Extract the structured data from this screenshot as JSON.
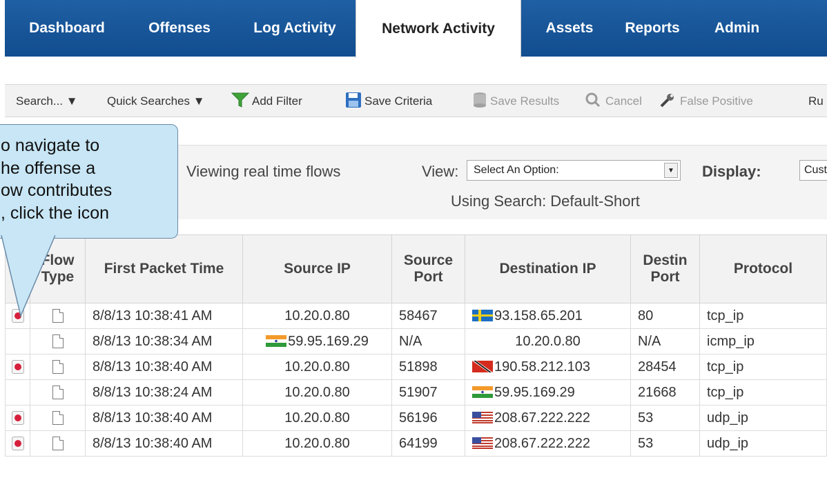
{
  "nav": {
    "tabs": [
      {
        "label": "Dashboard"
      },
      {
        "label": "Offenses"
      },
      {
        "label": "Log Activity"
      },
      {
        "label": "Network Activity",
        "active": true
      },
      {
        "label": "Assets"
      },
      {
        "label": "Reports"
      },
      {
        "label": "Admin"
      }
    ]
  },
  "toolbar": {
    "search": "Search... ▼",
    "quick_searches": "Quick Searches ▼",
    "add_filter": "Add Filter",
    "save_criteria": "Save Criteria",
    "save_results": "Save Results",
    "cancel": "Cancel",
    "false_positive": "False Positive",
    "rules_truncated": "Ru"
  },
  "info": {
    "viewing": "Viewing real time flows",
    "view_label": "View:",
    "view_value": "Select An Option:",
    "display_label": "Display:",
    "display_value": "Cust",
    "using_search": "Using Search: Default-Short"
  },
  "callout": {
    "lines": [
      "o navigate to",
      "he offense a",
      "ow contributes",
      ", click the icon"
    ]
  },
  "table": {
    "columns": [
      {
        "label": ""
      },
      {
        "label": "Flow Type"
      },
      {
        "label": "First Packet Time"
      },
      {
        "label": "Source IP"
      },
      {
        "label": "Source Port"
      },
      {
        "label": "Destination IP"
      },
      {
        "label": "Destin Port"
      },
      {
        "label": "Protocol"
      }
    ],
    "rows": [
      {
        "offense": true,
        "time": "8/8/13 10:38:41 AM",
        "src_ip": "10.20.0.80",
        "src_flag": "",
        "src_port": "58467",
        "dst_ip": "93.158.65.201",
        "dst_flag": "sweden",
        "dst_port": "80",
        "protocol": "tcp_ip"
      },
      {
        "offense": false,
        "time": "8/8/13 10:38:34 AM",
        "src_ip": "59.95.169.29",
        "src_flag": "india",
        "src_port": "N/A",
        "dst_ip": "10.20.0.80",
        "dst_flag": "",
        "dst_port": "N/A",
        "protocol": "icmp_ip"
      },
      {
        "offense": true,
        "time": "8/8/13 10:38:40 AM",
        "src_ip": "10.20.0.80",
        "src_flag": "",
        "src_port": "51898",
        "dst_ip": "190.58.212.103",
        "dst_flag": "trinidad",
        "dst_port": "28454",
        "protocol": "tcp_ip"
      },
      {
        "offense": false,
        "time": "8/8/13 10:38:24 AM",
        "src_ip": "10.20.0.80",
        "src_flag": "",
        "src_port": "51907",
        "dst_ip": "59.95.169.29",
        "dst_flag": "india",
        "dst_port": "21668",
        "protocol": "tcp_ip"
      },
      {
        "offense": true,
        "time": "8/8/13 10:38:40 AM",
        "src_ip": "10.20.0.80",
        "src_flag": "",
        "src_port": "56196",
        "dst_ip": "208.67.222.222",
        "dst_flag": "usa",
        "dst_port": "53",
        "protocol": "udp_ip"
      },
      {
        "offense": true,
        "time": "8/8/13 10:38:40 AM",
        "src_ip": "10.20.0.80",
        "src_flag": "",
        "src_port": "64199",
        "dst_ip": "208.67.222.222",
        "dst_flag": "usa",
        "dst_port": "53",
        "protocol": "udp_ip"
      }
    ]
  },
  "colors": {
    "nav_blue": "#1a5a9e",
    "offense_red": "#d6203c",
    "callout_fill": "#c8e6f5"
  }
}
